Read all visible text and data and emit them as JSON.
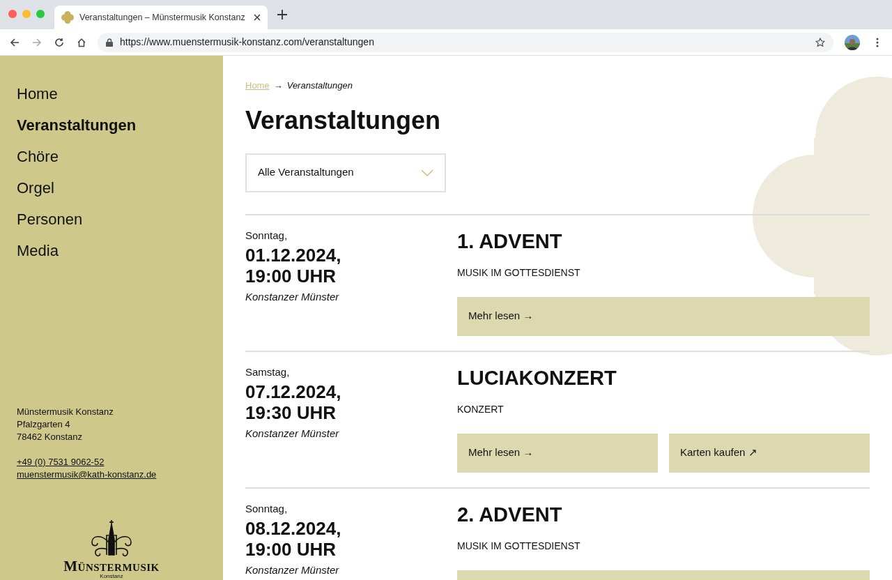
{
  "browser": {
    "tab_title": "Veranstaltungen – Münstermusik Konstanz",
    "url": "https://www.muenstermusik-konstanz.com/veranstaltungen"
  },
  "sidebar": {
    "items": [
      {
        "label": "Home",
        "selected": false
      },
      {
        "label": "Veranstaltungen",
        "selected": true
      },
      {
        "label": "Chöre",
        "selected": false
      },
      {
        "label": "Orgel",
        "selected": false
      },
      {
        "label": "Personen",
        "selected": false
      },
      {
        "label": "Media",
        "selected": false
      }
    ],
    "address": [
      "Münstermusik Konstanz",
      "Pfalzgarten 4",
      "78462 Konstanz"
    ],
    "phone": "+49 (0) 7531 9062-52",
    "email": "muenstermusik@kath-konstanz.de",
    "logo": {
      "name": "Münstermusik",
      "place": "Konstanz"
    }
  },
  "breadcrumb": {
    "link": "Home",
    "separator": "→",
    "current": "Veranstaltungen"
  },
  "title": "Veranstaltungen",
  "filter": {
    "value": "Alle Veranstaltungen"
  },
  "events": [
    {
      "weekday": "Sonntag,",
      "date": "01.12.2024,",
      "time": "19:00 UHR",
      "place": "Konstanzer Münster",
      "title": "1. ADVENT",
      "category": "MUSIK IM GOTTESDIENST",
      "buttons": [
        {
          "label": "Mehr lesen →"
        }
      ]
    },
    {
      "weekday": "Samstag,",
      "date": "07.12.2024,",
      "time": "19:30 UHR",
      "place": "Konstanzer Münster",
      "title": "LUCIAKONZERT",
      "category": "KONZERT",
      "buttons": [
        {
          "label": "Mehr lesen →"
        },
        {
          "label": "Karten kaufen ↗"
        }
      ]
    },
    {
      "weekday": "Sonntag,",
      "date": "08.12.2024,",
      "time": "19:00 UHR",
      "place": "Konstanzer Münster",
      "title": "2. ADVENT",
      "category": "MUSIK IM GOTTESDIENST",
      "buttons": [
        {
          "kind": "cut"
        }
      ]
    }
  ]
}
